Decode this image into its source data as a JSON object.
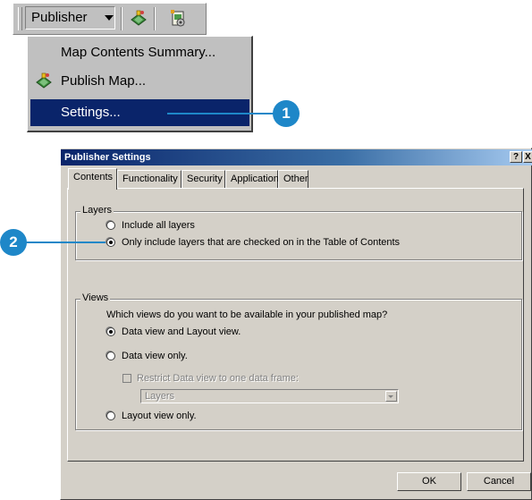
{
  "toolbar": {
    "publisher_menu": {
      "label": "Publisher",
      "icon": "chevron-down-icon"
    },
    "tool1_icon": "publish-map-icon",
    "tool2_icon": "map-settings-icon"
  },
  "menu": {
    "items": [
      {
        "label": "Map Contents Summary...",
        "accel": "C"
      },
      {
        "label": "Publish Map...",
        "accel": "P",
        "icon": "publish-map-icon"
      },
      {
        "label": "Settings...",
        "accel": "S",
        "selected": true
      }
    ]
  },
  "callouts": {
    "step1": "1",
    "step2": "2",
    "color": "#1e87c8"
  },
  "dialog": {
    "title": "Publisher Settings",
    "title_buttons": {
      "help": "?",
      "close": "X"
    },
    "tabs": [
      {
        "label": "Contents",
        "active": true
      },
      {
        "label": "Functionality"
      },
      {
        "label": "Security"
      },
      {
        "label": "Application"
      },
      {
        "label": "Other"
      }
    ],
    "layers_group": {
      "label": "Layers",
      "options": [
        {
          "label": "Include all layers",
          "checked": false
        },
        {
          "label": "Only include layers that are checked on in the Table of Contents",
          "checked": true
        }
      ]
    },
    "views_group": {
      "label": "Views",
      "question": "Which views do you want to be available in your published map?",
      "options": [
        {
          "label": "Data view and Layout view.",
          "checked": true
        },
        {
          "label": "Data view only.",
          "checked": false
        },
        {
          "label": "Layout view only.",
          "checked": false
        }
      ],
      "restrict": {
        "label": "Restrict Data view to one data frame:",
        "checked": false,
        "enabled": false
      },
      "frame_select": {
        "value": "Layers",
        "enabled": false
      }
    },
    "buttons": {
      "ok": "OK",
      "cancel": "Cancel"
    }
  },
  "colors": {
    "selection": "#0a246a",
    "dialog_face": "#d4d0c8",
    "toolbar_face": "#c0c0c0"
  }
}
